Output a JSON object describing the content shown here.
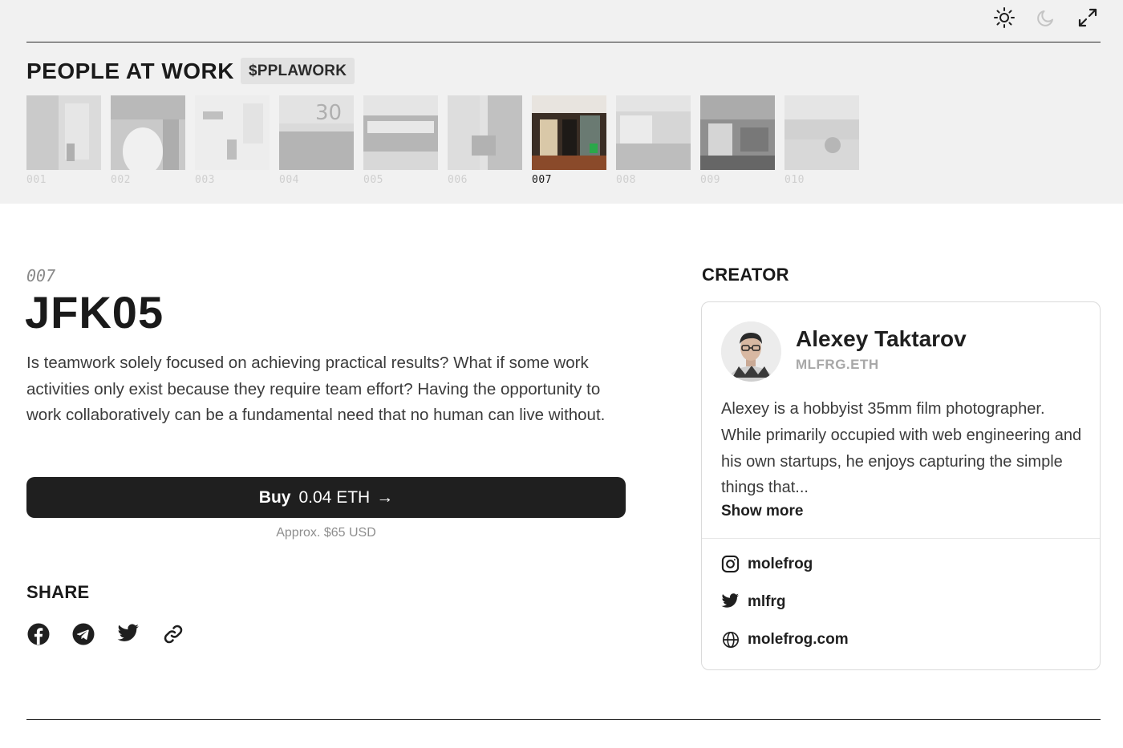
{
  "header": {
    "collection_title": "PEOPLE AT WORK",
    "ticker": "$PPLAWORK",
    "controls": [
      {
        "name": "light-mode",
        "icon": "sun-icon"
      },
      {
        "name": "dark-mode",
        "icon": "moon-icon"
      },
      {
        "name": "fullscreen",
        "icon": "expand-icon"
      }
    ]
  },
  "gallery": {
    "thumbnails": [
      {
        "number": "001",
        "state": "faded"
      },
      {
        "number": "002",
        "state": "faded"
      },
      {
        "number": "003",
        "state": "faded"
      },
      {
        "number": "004",
        "state": "faded"
      },
      {
        "number": "005",
        "state": "faded"
      },
      {
        "number": "006",
        "state": "faded"
      },
      {
        "number": "007",
        "state": "active"
      },
      {
        "number": "008",
        "state": "faded"
      },
      {
        "number": "009",
        "state": "dim"
      },
      {
        "number": "010",
        "state": "faded"
      }
    ]
  },
  "token": {
    "number": "007",
    "name": "JFK05",
    "description": "Is teamwork solely focused on achieving practical results? What if some work activities only exist because they require team effort? Having the opportunity to work collaboratively can be a fundamental need that no human can live without."
  },
  "purchase": {
    "buy_label": "Buy",
    "price": "0.04 ETH",
    "arrow": "→",
    "approx": "Approx. $65 USD"
  },
  "share": {
    "heading": "SHARE",
    "icons": [
      "facebook-icon",
      "telegram-icon",
      "twitter-icon",
      "link-icon"
    ]
  },
  "creator": {
    "heading": "CREATOR",
    "name": "Alexey Taktarov",
    "handle": "MLFRG.ETH",
    "bio": "Alexey is a hobbyist 35mm film photographer. While primarily occupied with web engineering and his own startups, he enjoys capturing the simple things that...",
    "show_more": "Show more",
    "links": {
      "instagram": "molefrog",
      "twitter": "mlfrg",
      "website": "molefrog.com"
    }
  },
  "colors": {
    "band": "#f1f1f1",
    "button": "#1f1f1f",
    "text": "#1f1f1f",
    "muted": "#8e8e8e"
  }
}
